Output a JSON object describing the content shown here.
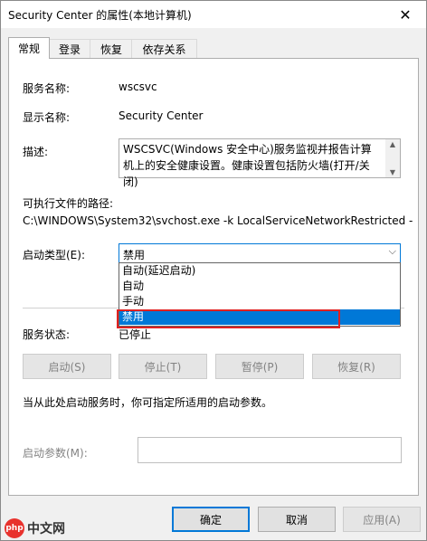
{
  "window": {
    "title": "Security Center 的属性(本地计算机)",
    "close_glyph": "✕"
  },
  "tabs": [
    {
      "label": "常规",
      "active": true
    },
    {
      "label": "登录",
      "active": false
    },
    {
      "label": "恢复",
      "active": false
    },
    {
      "label": "依存关系",
      "active": false
    }
  ],
  "general": {
    "service_name_label": "服务名称:",
    "service_name_value": "wscsvc",
    "display_name_label": "显示名称:",
    "display_name_value": "Security Center",
    "description_label": "描述:",
    "description_value": "WSCSVC(Windows 安全中心)服务监视并报告计算机上的安全健康设置。健康设置包括防火墙(打开/关闭)",
    "exe_path_label": "可执行文件的路径:",
    "exe_path_value": "C:\\WINDOWS\\System32\\svchost.exe -k LocalServiceNetworkRestricted -",
    "startup_type_label": "启动类型(E):",
    "startup_type_value": "禁用",
    "startup_options": [
      "自动(延迟启动)",
      "自动",
      "手动",
      "禁用"
    ],
    "highlighted_option_index": 3,
    "service_status_label": "服务状态:",
    "service_status_value": "已停止",
    "buttons": {
      "start": "启动(S)",
      "stop": "停止(T)",
      "pause": "暂停(P)",
      "resume": "恢复(R)"
    },
    "hint_text": "当从此处启动服务时，你可指定所适用的启动参数。",
    "start_params_label": "启动参数(M):",
    "start_params_value": ""
  },
  "footer": {
    "ok": "确定",
    "cancel": "取消",
    "apply": "应用(A)"
  },
  "watermark": {
    "logo_text": "php",
    "text": "中文网"
  },
  "colors": {
    "accent": "#0078d7",
    "highlight_box": "#e02020"
  }
}
